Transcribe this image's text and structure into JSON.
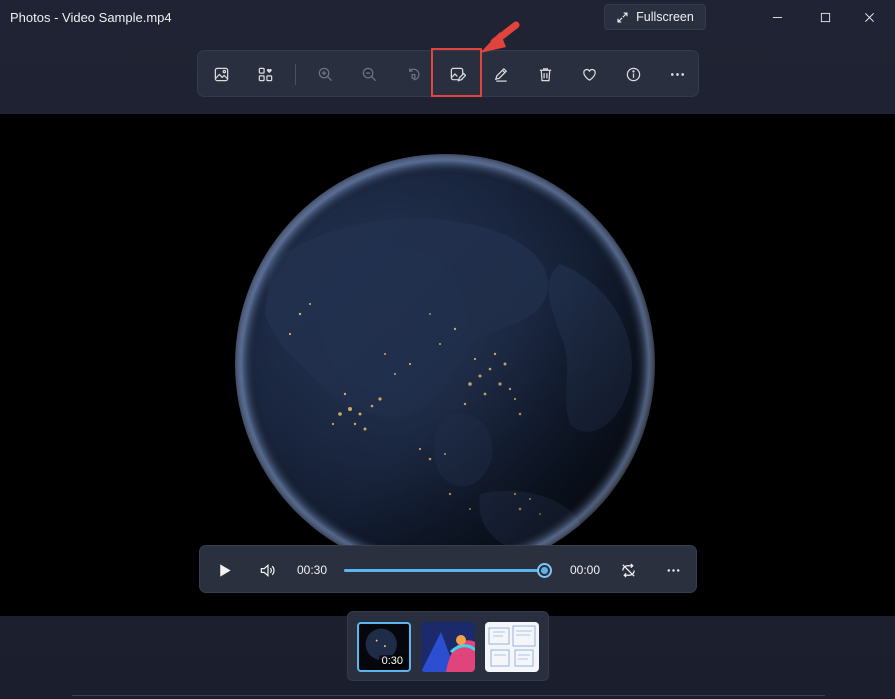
{
  "window": {
    "title": "Photos - Video Sample.mp4",
    "fullscreen_label": "Fullscreen"
  },
  "toolbar": {
    "highlighted_item": "edit-image-button",
    "items": [
      "view-photo-icon",
      "create-collage-icon",
      "zoom-in-icon",
      "zoom-out-icon",
      "rotate-icon",
      "edit-image-icon",
      "draw-icon",
      "delete-icon",
      "favorite-icon",
      "info-icon",
      "more-icon"
    ]
  },
  "player": {
    "current_time": "00:30",
    "remaining_time": "00:00",
    "progress": 1.0
  },
  "filmstrip": {
    "items": [
      {
        "duration": "0:30",
        "selected": true
      },
      {
        "duration": "",
        "selected": false
      },
      {
        "duration": "",
        "selected": false
      }
    ]
  },
  "colors": {
    "accent": "#5bb6f0",
    "annotation": "#e0443c",
    "background": "#1e2230"
  }
}
